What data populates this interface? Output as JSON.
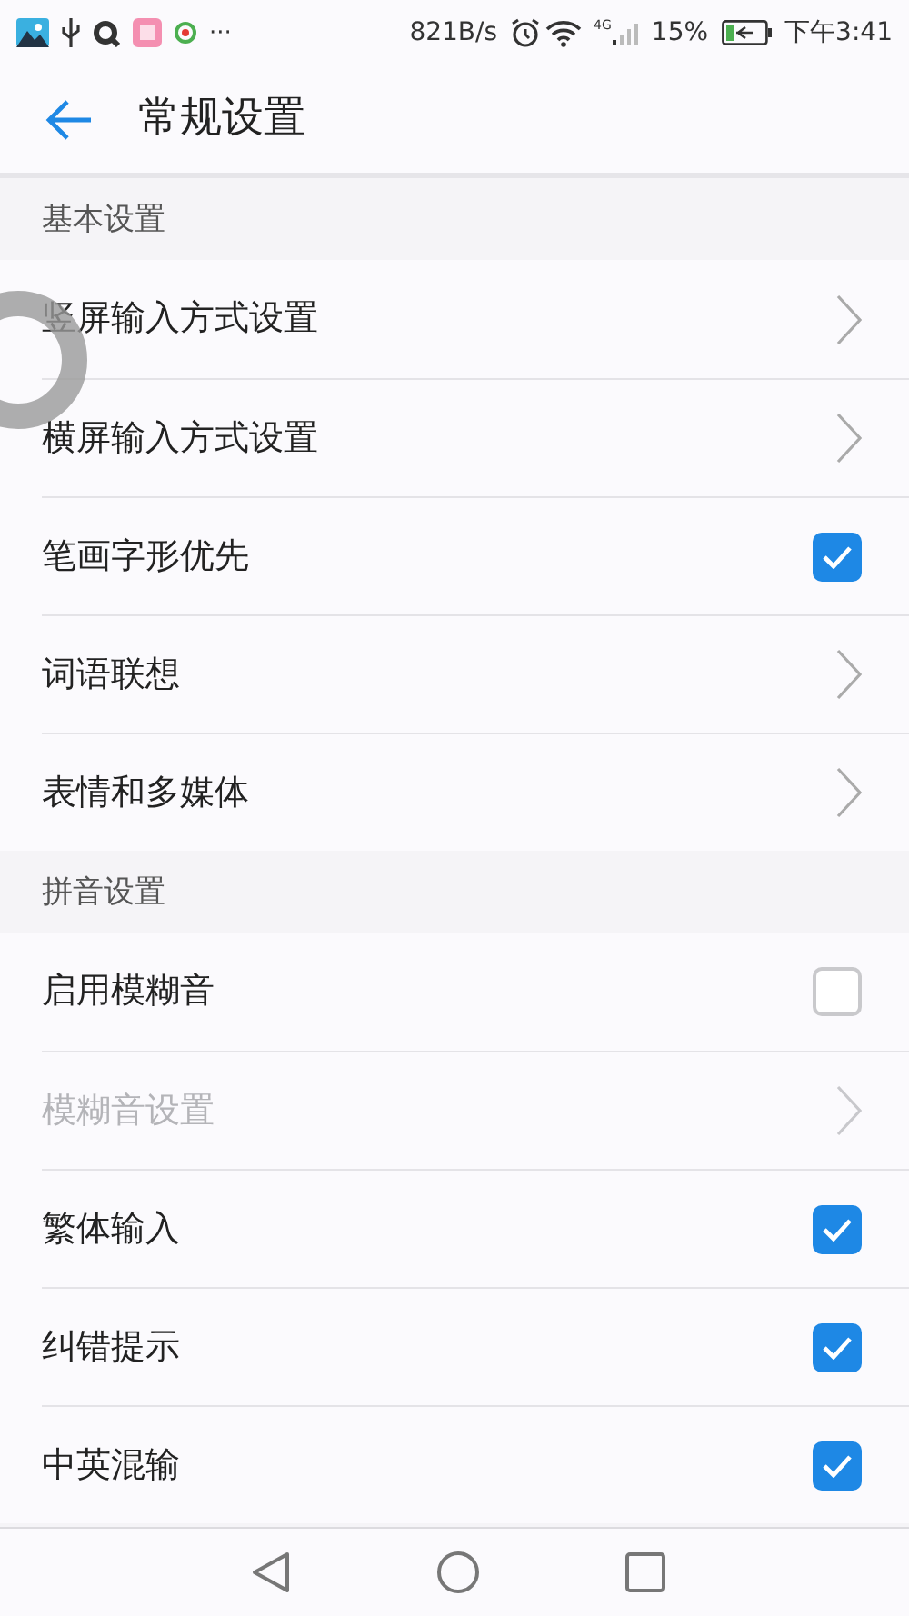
{
  "status_bar": {
    "speed": "821B/s",
    "network": "4G",
    "battery": "15%",
    "time": "下午3:41",
    "notification_more": "···"
  },
  "header": {
    "title": "常规设置"
  },
  "sections": [
    {
      "title": "基本设置",
      "items": [
        {
          "label": "竖屏输入方式设置",
          "kind": "chevron",
          "disabled": false
        },
        {
          "label": "横屏输入方式设置",
          "kind": "chevron",
          "disabled": false
        },
        {
          "label": "笔画字形优先",
          "kind": "checkbox",
          "checked": true
        },
        {
          "label": "词语联想",
          "kind": "chevron",
          "disabled": false
        },
        {
          "label": "表情和多媒体",
          "kind": "chevron",
          "disabled": false
        }
      ]
    },
    {
      "title": "拼音设置",
      "items": [
        {
          "label": "启用模糊音",
          "kind": "checkbox",
          "checked": false
        },
        {
          "label": "模糊音设置",
          "kind": "chevron",
          "disabled": true
        },
        {
          "label": "繁体输入",
          "kind": "checkbox",
          "checked": true
        },
        {
          "label": "纠错提示",
          "kind": "checkbox",
          "checked": true
        },
        {
          "label": "中英混输",
          "kind": "checkbox",
          "checked": true
        }
      ]
    }
  ]
}
